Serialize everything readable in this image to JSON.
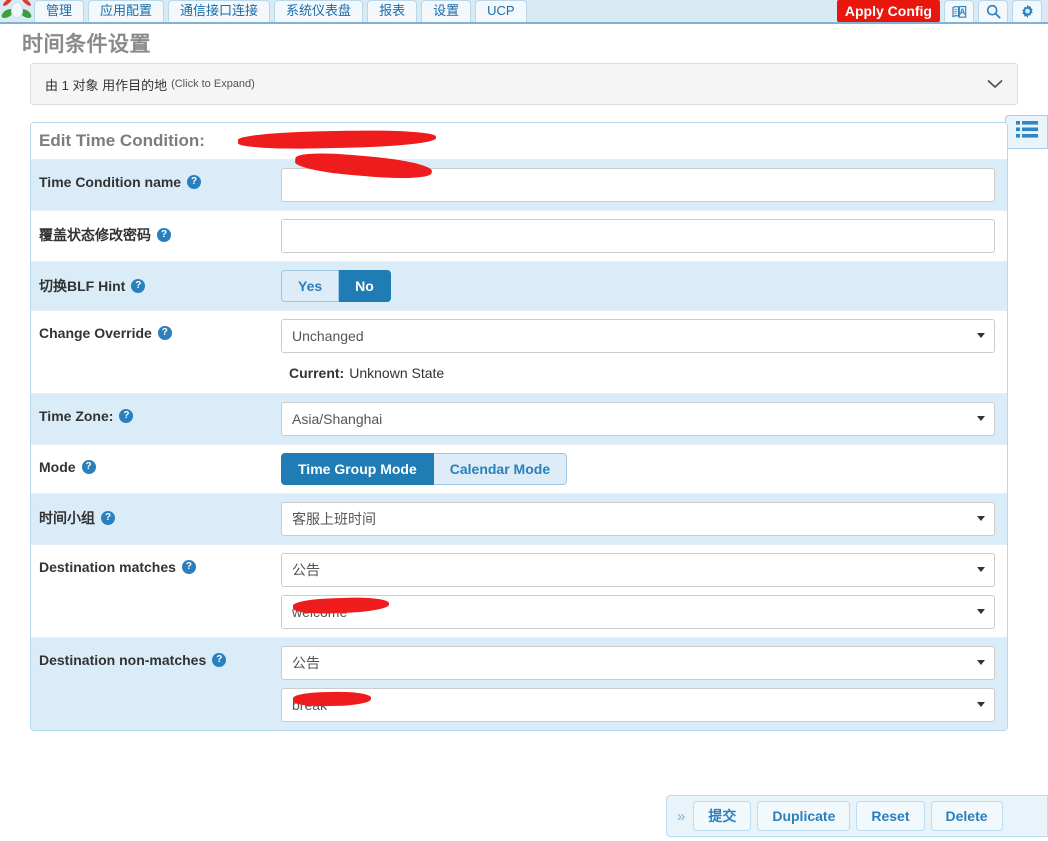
{
  "navbar": {
    "logo_name": "freepbx-logo",
    "tabs": [
      {
        "label": "管理",
        "name": "nav-tab-admin"
      },
      {
        "label": "应用配置",
        "name": "nav-tab-applications"
      },
      {
        "label": "通信接口连接",
        "name": "nav-tab-connectivity"
      },
      {
        "label": "系统仪表盘",
        "name": "nav-tab-dashboard"
      },
      {
        "label": "报表",
        "name": "nav-tab-reports"
      },
      {
        "label": "设置",
        "name": "nav-tab-settings"
      },
      {
        "label": "UCP",
        "name": "nav-tab-ucp"
      }
    ],
    "apply_config": "Apply Config",
    "apply_config_color": "#e8160c",
    "icons": [
      {
        "name": "language-translate-icon"
      },
      {
        "name": "search-icon"
      },
      {
        "name": "gear-icon"
      }
    ]
  },
  "page": {
    "title": "时间条件设置"
  },
  "expand_bar": {
    "text_main": "由 1 对象 用作目的地",
    "text_hint": "(Click to Expand)",
    "chevron": "⌄"
  },
  "side_button": {
    "name": "list-panel-toggle"
  },
  "panel": {
    "header_label": "Edit Time Condition:",
    "header_value_redacted": true,
    "rows": {
      "time_condition_name": {
        "label": "Time Condition name",
        "value": "",
        "redacted": true
      },
      "override_password": {
        "label": "覆盖状态修改密码",
        "value": "",
        "placeholder": ""
      },
      "blf_hint": {
        "label": "切换BLF Hint",
        "options": [
          "Yes",
          "No"
        ],
        "selected": "No"
      },
      "change_override": {
        "label": "Change Override",
        "value": "Unchanged"
      },
      "current_state": {
        "label": "Current:",
        "value": "Unknown State"
      },
      "time_zone": {
        "label": "Time Zone:",
        "value": "Asia/Shanghai"
      },
      "mode": {
        "label": "Mode",
        "options": [
          "Time Group Mode",
          "Calendar Mode"
        ],
        "selected": "Time Group Mode"
      },
      "time_group": {
        "label": "时间小组",
        "value": "客服上班时间"
      },
      "destination_matches": {
        "label": "Destination matches",
        "category": "公告",
        "target": "welcome",
        "target_redacted": true
      },
      "destination_non_matches": {
        "label": "Destination non-matches",
        "category": "公告",
        "target": "break",
        "target_redacted": true
      }
    }
  },
  "action_bar": {
    "chevron": "»",
    "buttons": [
      {
        "label": "提交",
        "name": "submit-button"
      },
      {
        "label": "Duplicate",
        "name": "duplicate-button"
      },
      {
        "label": "Reset",
        "name": "reset-button"
      },
      {
        "label": "Delete",
        "name": "delete-button"
      }
    ]
  },
  "colors": {
    "accent": "#2a7fbd",
    "selected": "#1f7cb5",
    "row_shade": "#d9ecf8",
    "navbar_bg": "#daeaf5",
    "redaction": "#ee1c1c"
  }
}
